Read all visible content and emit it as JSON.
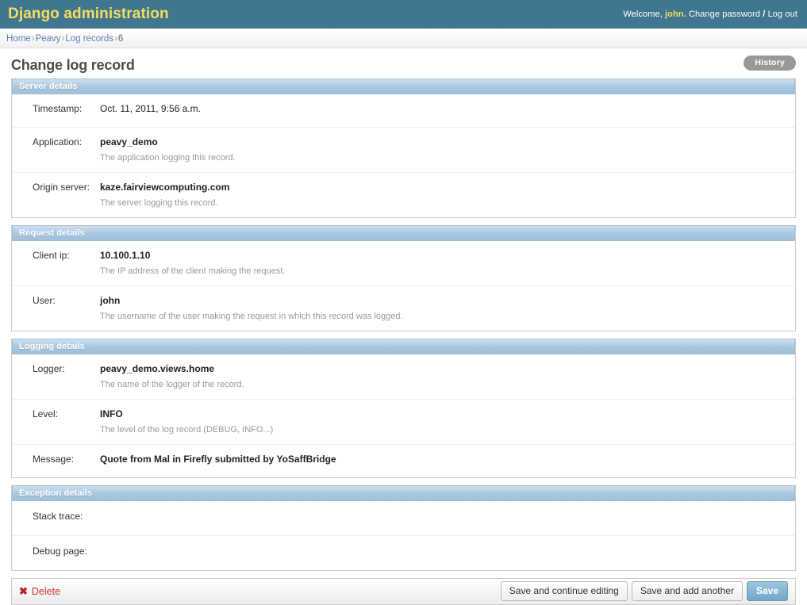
{
  "header": {
    "site_title": "Django administration",
    "welcome_text": "Welcome,",
    "username": "john.",
    "change_password_label": "Change password",
    "separator": "/",
    "logout_label": "Log out",
    "bg_color": "#417690",
    "title_color": "#f5dd5d"
  },
  "breadcrumbs": {
    "items": [
      {
        "label": "Home",
        "link": true
      },
      {
        "label": "Peavy",
        "link": true
      },
      {
        "label": "Log records",
        "link": true
      },
      {
        "label": "6",
        "link": false
      }
    ],
    "separator": "›"
  },
  "page": {
    "title": "Change log record",
    "history_label": "History"
  },
  "fieldsets": [
    {
      "legend": "Server details",
      "rows": [
        {
          "label": "Timestamp:",
          "value": "Oct. 11, 2011, 9:56 a.m.",
          "help": ""
        },
        {
          "label": "Application:",
          "value": "peavy_demo",
          "help": "The application logging this record."
        },
        {
          "label": "Origin server:",
          "value": "kaze.fairviewcomputing.com",
          "help": "The server logging this record."
        }
      ]
    },
    {
      "legend": "Request details",
      "rows": [
        {
          "label": "Client ip:",
          "value": "10.100.1.10",
          "help": "The IP address of the client making the request."
        },
        {
          "label": "User:",
          "value": "john",
          "help": "The username of the user making the request in which this record was logged."
        }
      ]
    },
    {
      "legend": "Logging details",
      "rows": [
        {
          "label": "Logger:",
          "value": "peavy_demo.views.home",
          "help": "The name of the logger of the record."
        },
        {
          "label": "Level:",
          "value": "INFO",
          "help": "The level of the log record (DEBUG, INFO...)"
        },
        {
          "label": "Message:",
          "value": "Quote from Mal in Firefly submitted by YoSaffBridge",
          "help": ""
        }
      ]
    },
    {
      "legend": "Exception details",
      "rows": [
        {
          "label": "Stack trace:",
          "value": "",
          "help": ""
        },
        {
          "label": "Debug page:",
          "value": "",
          "help": ""
        }
      ]
    }
  ],
  "submit_row": {
    "delete_label": "Delete",
    "delete_icon": "cross-icon",
    "delete_color": "#cc3333",
    "save_continue_label": "Save and continue editing",
    "save_add_another_label": "Save and add another",
    "save_label": "Save",
    "save_color": "#79aec8"
  }
}
